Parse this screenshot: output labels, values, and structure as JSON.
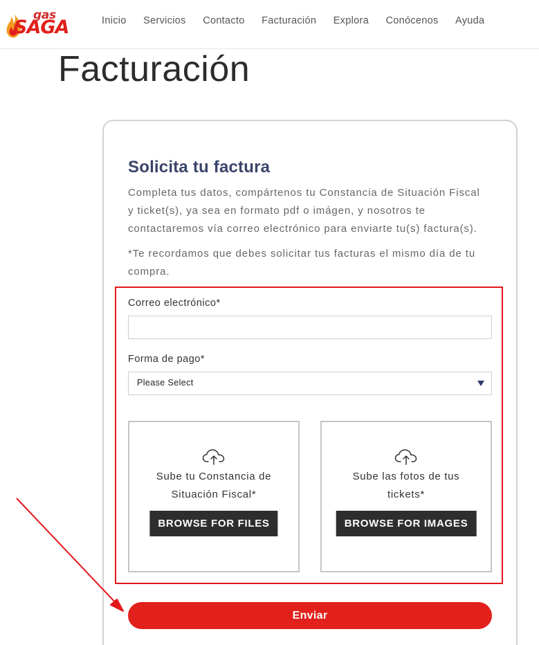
{
  "brand": {
    "logo_top": "gas",
    "logo_main": "SAGA",
    "colors": {
      "red": "#e0201c",
      "flame_orange": "#f39a1f",
      "title_navy": "#3a4469"
    }
  },
  "nav": {
    "items": [
      {
        "label": "Inicio"
      },
      {
        "label": "Servicios"
      },
      {
        "label": "Contacto"
      },
      {
        "label": "Facturación"
      },
      {
        "label": "Explora"
      },
      {
        "label": "Conócenos"
      },
      {
        "label": "Ayuda"
      }
    ]
  },
  "page": {
    "title": "Facturación"
  },
  "form": {
    "title": "Solicita tu factura",
    "description_lines": [
      "Completa tus datos, compártenos tu Constancia de Situación Fiscal",
      "y ticket(s), ya sea en formato pdf o imágen, y nosotros te",
      "contactaremos vía correo electrónico para enviarte tu(s) factura(s)."
    ],
    "note_lines": [
      "*Te recordamos que debes solicitar tus facturas el mismo día de tu",
      "compra."
    ],
    "email": {
      "label": "Correo electrónico*",
      "value": "",
      "placeholder": ""
    },
    "payment": {
      "label": "Forma de pago*",
      "selected": "Please Select"
    },
    "uploads": [
      {
        "icon": "cloud-upload-icon",
        "text_lines": [
          "Sube tu Constancia de",
          "Situación Fiscal*"
        ],
        "button": "BROWSE FOR FILES"
      },
      {
        "icon": "cloud-upload-icon",
        "text_lines": [
          "Sube las fotos de tus",
          "tickets*"
        ],
        "button": "BROWSE FOR IMAGES"
      }
    ],
    "submit_label": "Enviar"
  },
  "annotations": {
    "highlight_color": "#e3161c",
    "arrow_color": "#e3161c"
  }
}
